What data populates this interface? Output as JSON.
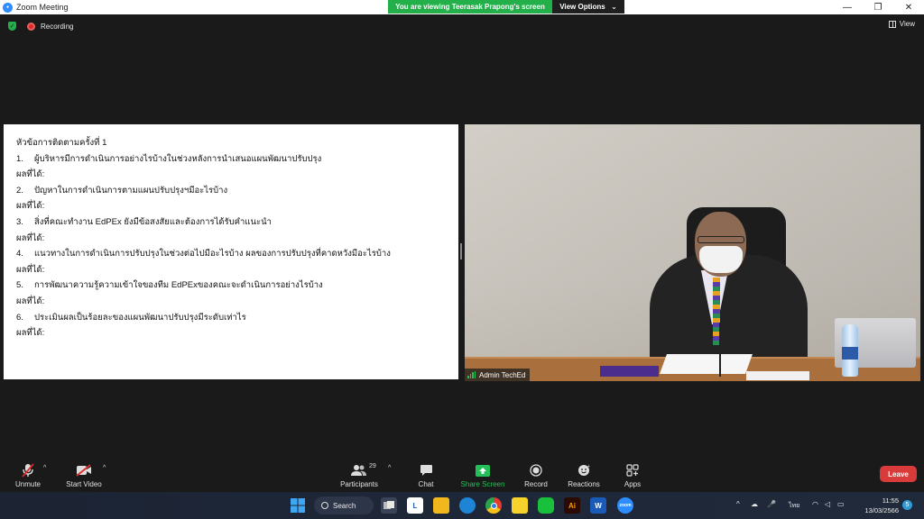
{
  "window": {
    "title": "Zoom Meeting",
    "app_icon": "zoom-icon",
    "controls": [
      "—",
      "❐",
      "✕"
    ]
  },
  "banner": {
    "viewing_text": "You are viewing Teerasak Prapong's screen",
    "view_options_label": "View Options",
    "color": "#23b04a"
  },
  "topbar": {
    "recording_label": "Recording",
    "view_label": "View"
  },
  "shared_doc": {
    "heading": "หัวข้อการติดตามครั้งที่ 1",
    "result_label": "ผลที่ได้:",
    "items": [
      {
        "num": "1.",
        "text": "ผู้บริหารมีการดำเนินการอย่างไรบ้างในช่วงหลังการนำเสนอแผนพัฒนาปรับปรุง"
      },
      {
        "num": "2.",
        "text": "ปัญหาในการดำเนินการตามแผนปรับปรุงฯมีอะไรบ้าง"
      },
      {
        "num": "3.",
        "text": "สิ่งที่คณะทำงาน EdPEx ยังมีข้อสงสัยและต้องการได้รับคำแนะนำ"
      },
      {
        "num": "4.",
        "text": "แนวทางในการดำเนินการปรับปรุงในช่วงต่อไปมีอะไรบ้าง ผลของการปรับปรุงที่คาดหวังมีอะไรบ้าง"
      },
      {
        "num": "5.",
        "text": "การพัฒนาความรู้ความเข้าใจของทีม EdPExของคณะจะดำเนินการอย่างไรบ้าง"
      },
      {
        "num": "6.",
        "text": "ประเมินผลเป็นร้อยละของแผนพัฒนาปรับปรุงมีระดับเท่าไร"
      }
    ]
  },
  "video": {
    "participant_name": "Admin TechEd"
  },
  "toolbar": {
    "unmute_label": "Unmute",
    "start_video_label": "Start Video",
    "participants_label": "Participants",
    "participants_count": "29",
    "chat_label": "Chat",
    "share_screen_label": "Share Screen",
    "record_label": "Record",
    "reactions_label": "Reactions",
    "apps_label": "Apps",
    "leave_label": "Leave",
    "leave_color": "#d93a3a",
    "share_color": "#23c05a"
  },
  "taskbar": {
    "search_label": "Search",
    "language": "ไทย",
    "time": "11:55",
    "date": "13/03/2566",
    "notification_count": "5",
    "apps": [
      "windows-start-icon",
      "task-view-icon",
      "teams-icon",
      "file-explorer-icon",
      "edge-icon",
      "chrome-icon",
      "sticky-notes-icon",
      "line-icon",
      "illustrator-icon",
      "word-icon",
      "zoom-icon"
    ]
  }
}
